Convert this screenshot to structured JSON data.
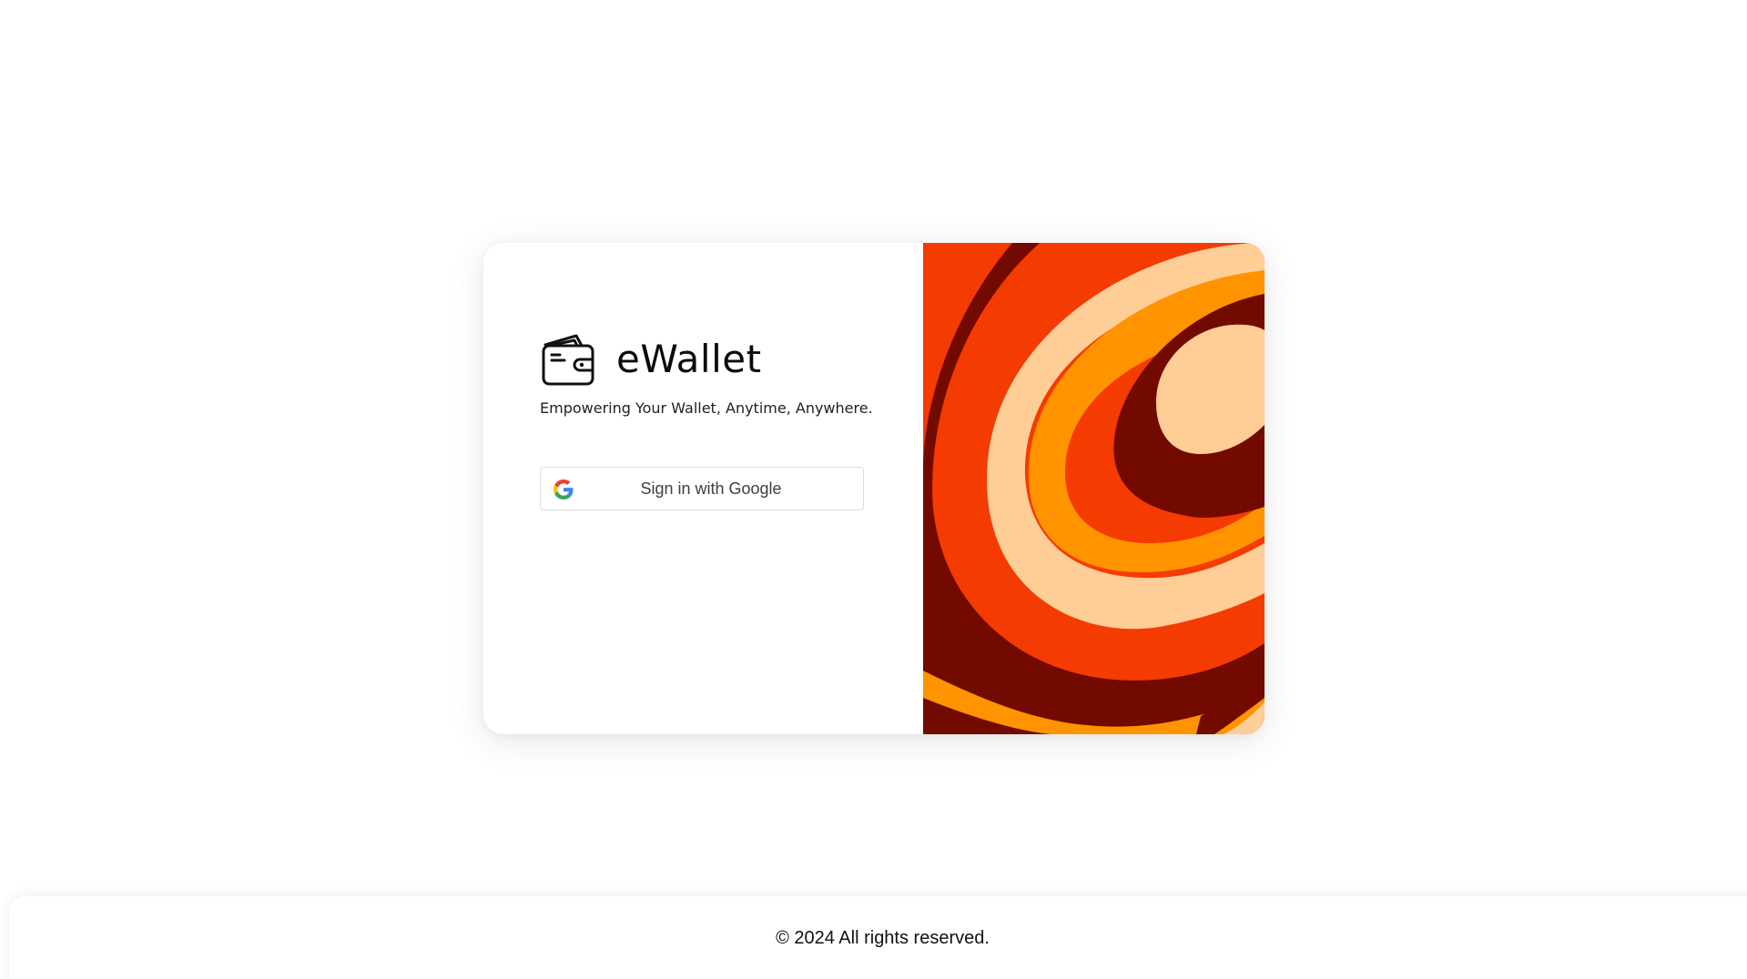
{
  "brand": {
    "name": "eWallet",
    "icon": "wallet-icon",
    "tagline": "Empowering Your Wallet, Anytime, Anywhere."
  },
  "auth": {
    "google_button_label": "Sign in with Google",
    "google_icon": "google-g-icon"
  },
  "art": {
    "colors": {
      "dark_red": "#720a00",
      "red_orange": "#f43b02",
      "orange": "#ff9300",
      "peach": "#ffcd96"
    }
  },
  "footer": {
    "copyright": "© 2024 All rights reserved."
  }
}
